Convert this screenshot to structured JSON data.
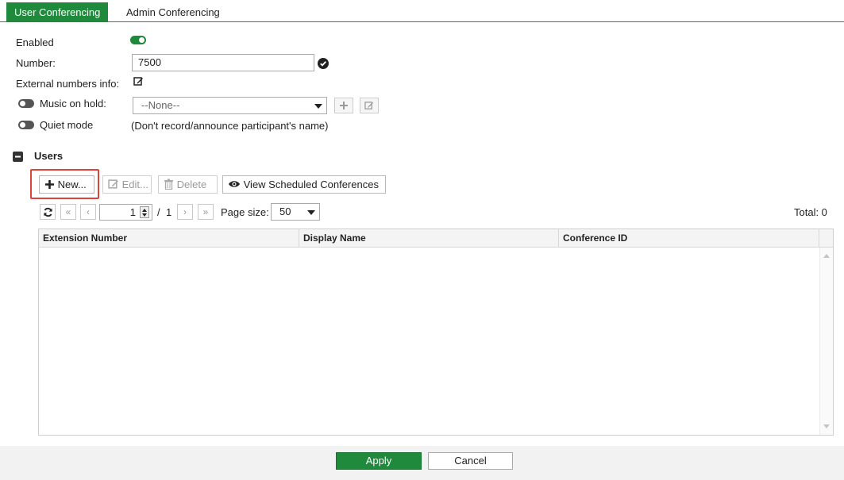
{
  "tabs": [
    {
      "label": "User Conferencing",
      "active": true
    },
    {
      "label": "Admin Conferencing",
      "active": false
    }
  ],
  "form": {
    "enabled_label": "Enabled",
    "enabled_value": true,
    "number_label": "Number:",
    "number_value": "7500",
    "external_label": "External numbers info:",
    "music_label": "Music on hold:",
    "music_toggle": false,
    "music_select_value": "--None--",
    "quiet_label": "Quiet mode",
    "quiet_toggle": false,
    "quiet_note": "(Don't record/announce participant's name)"
  },
  "users": {
    "section_title": "Users",
    "toolbar": {
      "new_label": "New...",
      "edit_label": "Edit...",
      "delete_label": "Delete",
      "view_label": "View Scheduled Conferences"
    },
    "pager": {
      "current_page": "1",
      "separator": "/",
      "total_pages": "1",
      "page_size_label": "Page size:",
      "page_size_value": "50",
      "total_label": "Total: 0"
    },
    "columns": [
      "Extension Number",
      "Display Name",
      "Conference ID"
    ],
    "rows": []
  },
  "footer": {
    "apply_label": "Apply",
    "cancel_label": "Cancel"
  },
  "colors": {
    "accent": "#1f8a3b",
    "highlight": "#e0413b"
  }
}
